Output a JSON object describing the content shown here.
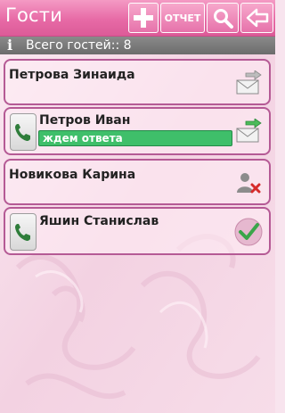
{
  "app": {
    "title": "Гости"
  },
  "toolbar": {
    "add_icon": "plus-icon",
    "report_label": "ОТЧЕТ",
    "search_icon": "search-icon",
    "back_icon": "back-arrow-icon"
  },
  "summary": {
    "info_icon": "info-icon",
    "text": "Всего гостей:: 8"
  },
  "guests": [
    {
      "name": "Петрова Зинаида",
      "has_phone": false,
      "status": "",
      "action_icon": "send-invitation-icon"
    },
    {
      "name": "Петров Иван",
      "has_phone": true,
      "status": "ждем ответа",
      "action_icon": "send-invitation-icon"
    },
    {
      "name": "Новикова Карина",
      "has_phone": false,
      "status": "",
      "action_icon": "declined-person-icon"
    },
    {
      "name": "Яшин Станислав",
      "has_phone": true,
      "status": "",
      "action_icon": "accepted-check-icon"
    }
  ],
  "colors": {
    "toolbar": "#e76aa6",
    "card_border": "#b55a95",
    "status_pending": "#3fbf6a",
    "background": "#f8e4ee"
  }
}
